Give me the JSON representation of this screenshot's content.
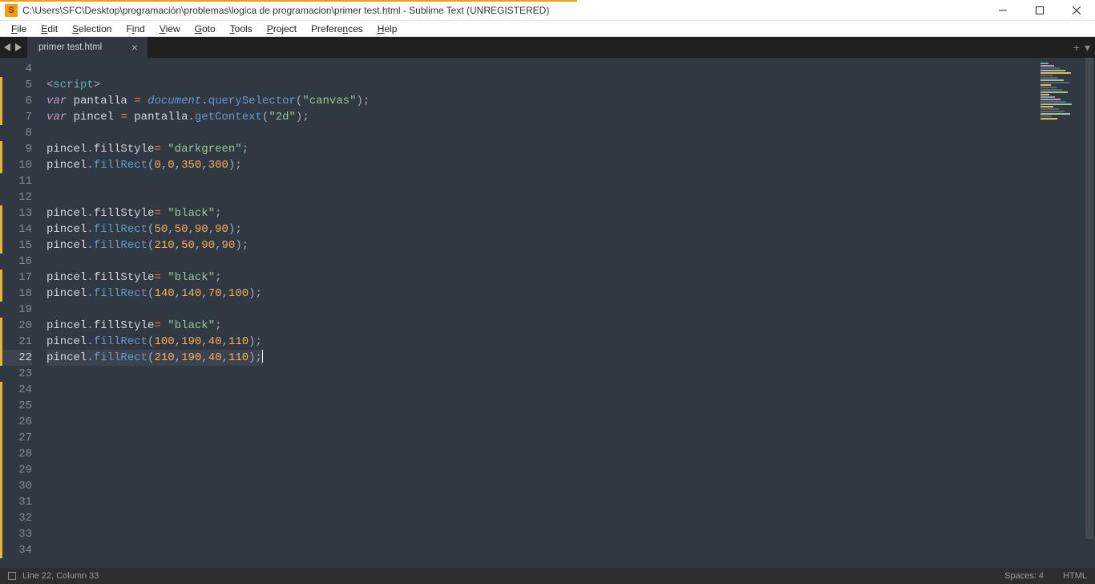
{
  "window": {
    "title": "C:\\Users\\SFC\\Desktop\\programación\\problemas\\logica de programacion\\primer test.html - Sublime Text (UNREGISTERED)",
    "app_icon_letter": "S"
  },
  "menu": {
    "items": [
      {
        "underline": "F",
        "rest": "ile"
      },
      {
        "underline": "E",
        "rest": "dit"
      },
      {
        "underline": "S",
        "rest": "election"
      },
      {
        "underline": "",
        "rest": "F",
        "u2": "i",
        "rest2": "nd"
      },
      {
        "underline": "V",
        "rest": "iew"
      },
      {
        "underline": "G",
        "rest": "oto"
      },
      {
        "underline": "T",
        "rest": "ools"
      },
      {
        "underline": "P",
        "rest": "roject"
      },
      {
        "underline": "",
        "rest": "Prefere",
        "u2": "n",
        "rest2": "ces"
      },
      {
        "underline": "H",
        "rest": "elp"
      }
    ]
  },
  "tabs": {
    "active": {
      "label": "primer test.html"
    }
  },
  "editor": {
    "first_line_number": 4,
    "active_line": 22,
    "lines": [
      {
        "n": 4,
        "mark": false,
        "html": ""
      },
      {
        "n": 5,
        "mark": true,
        "html": "<span class='tok-angle'>&lt;</span><span class='tok-tag'>script</span><span class='tok-angle'>&gt;</span>"
      },
      {
        "n": 6,
        "mark": true,
        "html": "<span class='tok-kw'>var</span> <span class='tok-var'>pantalla</span> <span class='tok-op'>=</span> <span class='tok-builtin'>document</span><span class='tok-punc'>.</span><span class='tok-method'>querySelector</span><span class='tok-punc'>(</span><span class='tok-str'>\"canvas\"</span><span class='tok-punc'>);</span>"
      },
      {
        "n": 7,
        "mark": true,
        "html": "<span class='tok-kw'>var</span> <span class='tok-var'>pincel</span> <span class='tok-op'>=</span> <span class='tok-var'>pantalla</span><span class='tok-punc'>.</span><span class='tok-method'>getContext</span><span class='tok-punc'>(</span><span class='tok-str'>\"2d\"</span><span class='tok-punc'>);</span>"
      },
      {
        "n": 8,
        "mark": false,
        "html": ""
      },
      {
        "n": 9,
        "mark": true,
        "html": "<span class='tok-var'>pincel</span><span class='tok-punc'>.</span><span class='tok-prop'>fillStyle</span><span class='tok-op'>=</span> <span class='tok-str'>\"darkgreen\"</span><span class='tok-punc'>;</span>"
      },
      {
        "n": 10,
        "mark": true,
        "html": "<span class='tok-var'>pincel</span><span class='tok-punc'>.</span><span class='tok-method'>fillRect</span><span class='tok-punc'>(</span><span class='tok-num'>0</span><span class='tok-punc'>,</span><span class='tok-num'>0</span><span class='tok-punc'>,</span><span class='tok-num'>350</span><span class='tok-punc'>,</span><span class='tok-num'>300</span><span class='tok-punc'>);</span>"
      },
      {
        "n": 11,
        "mark": false,
        "html": ""
      },
      {
        "n": 12,
        "mark": false,
        "html": ""
      },
      {
        "n": 13,
        "mark": true,
        "html": "<span class='tok-var'>pincel</span><span class='tok-punc'>.</span><span class='tok-prop'>fillStyle</span><span class='tok-op'>=</span> <span class='tok-str'>\"black\"</span><span class='tok-punc'>;</span>"
      },
      {
        "n": 14,
        "mark": true,
        "html": "<span class='tok-var'>pincel</span><span class='tok-punc'>.</span><span class='tok-method'>fillRect</span><span class='tok-punc'>(</span><span class='tok-num'>50</span><span class='tok-punc'>,</span><span class='tok-num'>50</span><span class='tok-punc'>,</span><span class='tok-num'>90</span><span class='tok-punc'>,</span><span class='tok-num'>90</span><span class='tok-punc'>);</span>"
      },
      {
        "n": 15,
        "mark": true,
        "html": "<span class='tok-var'>pincel</span><span class='tok-punc'>.</span><span class='tok-method'>fillRect</span><span class='tok-punc'>(</span><span class='tok-num'>210</span><span class='tok-punc'>,</span><span class='tok-num'>50</span><span class='tok-punc'>,</span><span class='tok-num'>90</span><span class='tok-punc'>,</span><span class='tok-num'>90</span><span class='tok-punc'>);</span>"
      },
      {
        "n": 16,
        "mark": false,
        "html": ""
      },
      {
        "n": 17,
        "mark": true,
        "html": "<span class='tok-var'>pincel</span><span class='tok-punc'>.</span><span class='tok-prop'>fillStyle</span><span class='tok-op'>=</span> <span class='tok-str'>\"black\"</span><span class='tok-punc'>;</span>"
      },
      {
        "n": 18,
        "mark": true,
        "html": "<span class='tok-var'>pincel</span><span class='tok-punc'>.</span><span class='tok-method'>fillRect</span><span class='tok-punc'>(</span><span class='tok-num'>140</span><span class='tok-punc'>,</span><span class='tok-num'>140</span><span class='tok-punc'>,</span><span class='tok-num'>70</span><span class='tok-punc'>,</span><span class='tok-num'>100</span><span class='tok-punc'>);</span>"
      },
      {
        "n": 19,
        "mark": false,
        "html": ""
      },
      {
        "n": 20,
        "mark": true,
        "html": "<span class='tok-var'>pincel</span><span class='tok-punc'>.</span><span class='tok-prop'>fillStyle</span><span class='tok-op'>=</span> <span class='tok-str'>\"black\"</span><span class='tok-punc'>;</span>"
      },
      {
        "n": 21,
        "mark": true,
        "html": "<span class='tok-var'>pincel</span><span class='tok-punc'>.</span><span class='tok-method'>fillRect</span><span class='tok-punc'>(</span><span class='tok-num'>100</span><span class='tok-punc'>,</span><span class='tok-num'>190</span><span class='tok-punc'>,</span><span class='tok-num'>40</span><span class='tok-punc'>,</span><span class='tok-num'>110</span><span class='tok-punc'>);</span>"
      },
      {
        "n": 22,
        "mark": true,
        "html": "<span class='tok-var'>pincel</span><span class='tok-punc'>.</span><span class='tok-method'>fillRect</span><span class='tok-punc'>(</span><span class='tok-num'>210</span><span class='tok-punc'>,</span><span class='tok-num'>190</span><span class='tok-punc'>,</span><span class='tok-num'>40</span><span class='tok-punc'>,</span><span class='tok-num'>110</span><span class='tok-punc'>);</span><span class='caret'></span>"
      },
      {
        "n": 23,
        "mark": false,
        "html": ""
      },
      {
        "n": 24,
        "mark": true,
        "html": ""
      },
      {
        "n": 25,
        "mark": true,
        "html": ""
      },
      {
        "n": 26,
        "mark": true,
        "html": ""
      },
      {
        "n": 27,
        "mark": true,
        "html": ""
      },
      {
        "n": 28,
        "mark": true,
        "html": ""
      },
      {
        "n": 29,
        "mark": true,
        "html": ""
      },
      {
        "n": 30,
        "mark": true,
        "html": ""
      },
      {
        "n": 31,
        "mark": true,
        "html": ""
      },
      {
        "n": 32,
        "mark": true,
        "html": ""
      },
      {
        "n": 33,
        "mark": true,
        "html": ""
      },
      {
        "n": 34,
        "mark": true,
        "html": ""
      }
    ]
  },
  "statusbar": {
    "position": "Line 22, Column 33",
    "spaces": "Spaces: 4",
    "syntax": "HTML"
  },
  "tab_tools": {
    "plus": "+",
    "down": "▾"
  }
}
